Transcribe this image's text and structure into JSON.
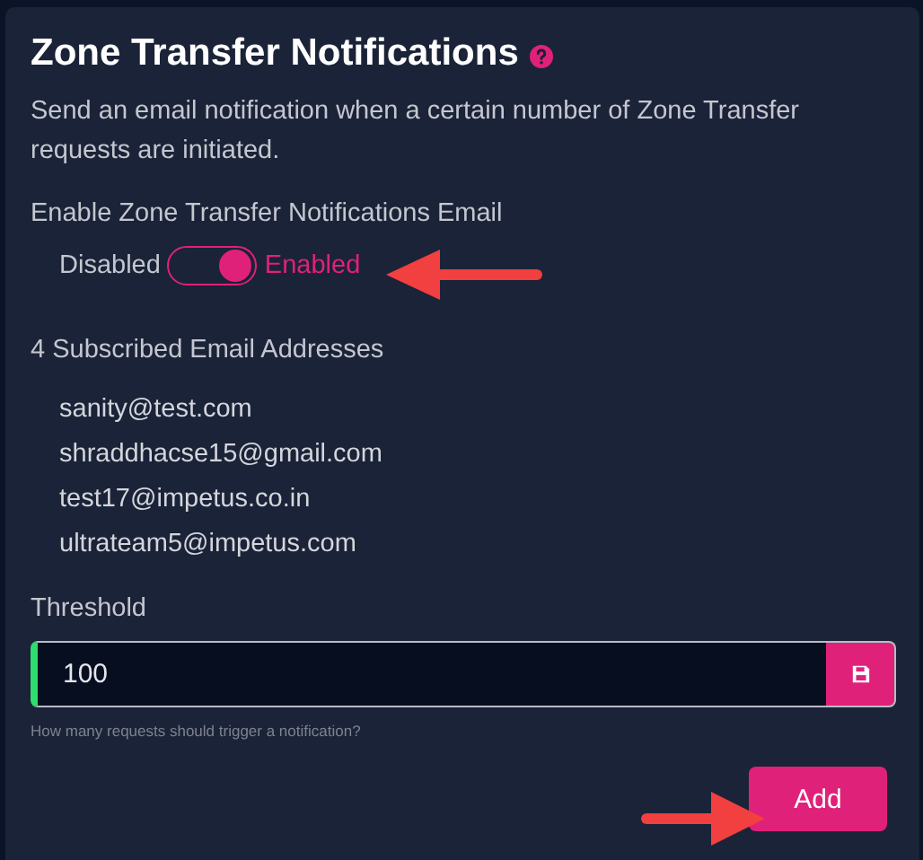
{
  "title": "Zone Transfer Notifications",
  "description": "Send an email notification when a certain number of Zone Transfer requests are initiated.",
  "toggle": {
    "label": "Enable Zone Transfer Notifications Email",
    "off_label": "Disabled",
    "on_label": "Enabled",
    "on": true
  },
  "subscribed_label": "4 Subscribed Email Addresses",
  "emails": [
    "sanity@test.com",
    "shraddhacse15@gmail.com",
    "test17@impetus.co.in",
    "ultrateam5@impetus.com"
  ],
  "threshold": {
    "label": "Threshold",
    "value": "100",
    "hint": "How many requests should trigger a notification?"
  },
  "add_button": "Add"
}
